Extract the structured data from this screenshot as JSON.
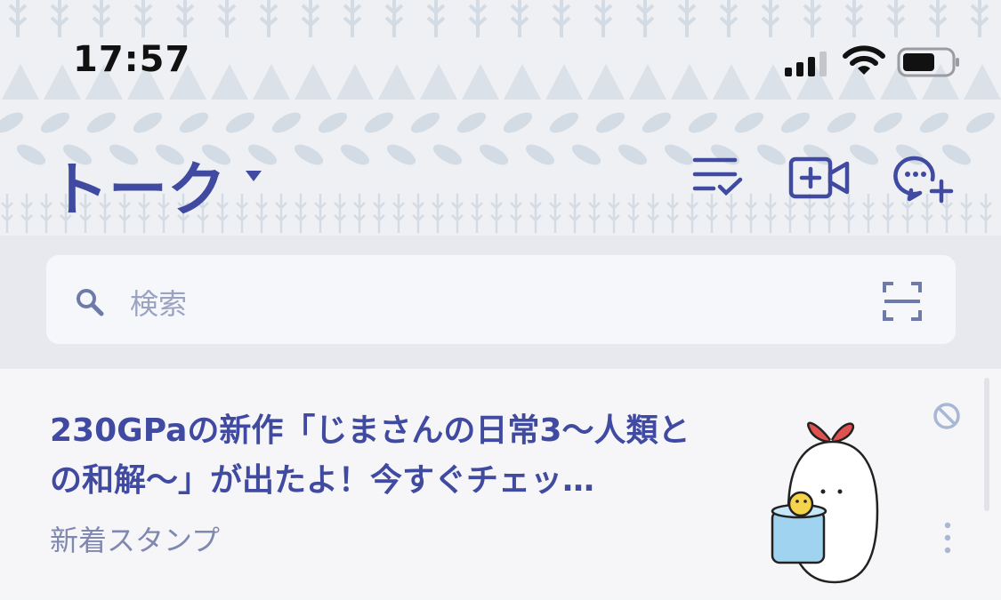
{
  "status_bar": {
    "time": "17:57"
  },
  "header": {
    "title": "トーク",
    "icons": [
      "checklist-icon",
      "video-call-plus-icon",
      "chat-plus-icon"
    ]
  },
  "search": {
    "placeholder": "検索"
  },
  "chat_item": {
    "message": "230GPaの新作「じまさんの日常3〜人類との和解〜」が出たよ！今すぐチェッ…",
    "subtitle": "新着スタンプ"
  },
  "colors": {
    "accent": "#3f4aa0",
    "header_bg": "#eef0f4",
    "pattern": "#d5dde6"
  }
}
